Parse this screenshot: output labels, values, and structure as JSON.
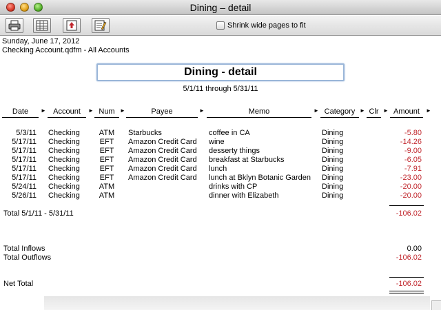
{
  "window": {
    "title": "Dining – detail"
  },
  "toolbar": {
    "buttons": [
      {
        "icon": "print-icon"
      },
      {
        "icon": "spreadsheet-icon"
      },
      {
        "icon": "export-icon"
      },
      {
        "icon": "customize-report-icon"
      }
    ],
    "shrink_label": "Shrink wide pages to fit",
    "shrink_checked": false
  },
  "report": {
    "date_line": "Sunday, June 17, 2012",
    "file_line": "Checking Account.qdfm - All Accounts",
    "title": "Dining - detail",
    "range": "5/1/11 through 5/31/11"
  },
  "columns": {
    "date": "Date",
    "account": "Account",
    "num": "Num",
    "payee": "Payee",
    "memo": "Memo",
    "category": "Category",
    "clr": "Clr",
    "amount": "Amount"
  },
  "rows": [
    {
      "date": "5/3/11",
      "account": "Checking",
      "num": "ATM",
      "payee": "Starbucks",
      "memo": "coffee in CA",
      "category": "Dining",
      "amount": "-5.80"
    },
    {
      "date": "5/17/11",
      "account": "Checking",
      "num": "EFT",
      "payee": "Amazon Credit Card",
      "memo": "wine",
      "category": "Dining",
      "amount": "-14.26"
    },
    {
      "date": "5/17/11",
      "account": "Checking",
      "num": "EFT",
      "payee": "Amazon Credit Card",
      "memo": "desserty things",
      "category": "Dining",
      "amount": "-9.00"
    },
    {
      "date": "5/17/11",
      "account": "Checking",
      "num": "EFT",
      "payee": "Amazon Credit Card",
      "memo": "breakfast at Starbucks",
      "category": "Dining",
      "amount": "-6.05"
    },
    {
      "date": "5/17/11",
      "account": "Checking",
      "num": "EFT",
      "payee": "Amazon Credit Card",
      "memo": "lunch",
      "category": "Dining",
      "amount": "-7.91"
    },
    {
      "date": "5/17/11",
      "account": "Checking",
      "num": "EFT",
      "payee": "Amazon Credit Card",
      "memo": "lunch at Bklyn Botanic Garden",
      "category": "Dining",
      "amount": "-23.00"
    },
    {
      "date": "5/24/11",
      "account": "Checking",
      "num": "ATM",
      "payee": "",
      "memo": "drinks with CP",
      "category": "Dining",
      "amount": "-20.00"
    },
    {
      "date": "5/26/11",
      "account": "Checking",
      "num": "ATM",
      "payee": "",
      "memo": "dinner with Elizabeth",
      "category": "Dining",
      "amount": "-20.00"
    }
  ],
  "totals": {
    "period_label": "Total 5/1/11 - 5/31/11",
    "period_amount": "-106.02",
    "inflows_label": "Total Inflows",
    "inflows_amount": "0.00",
    "outflows_label": "Total Outflows",
    "outflows_amount": "-106.02",
    "net_label": "Net Total",
    "net_amount": "-106.02"
  },
  "colors": {
    "negative": "#c1272d",
    "title_focus": "#9ab6d8"
  }
}
